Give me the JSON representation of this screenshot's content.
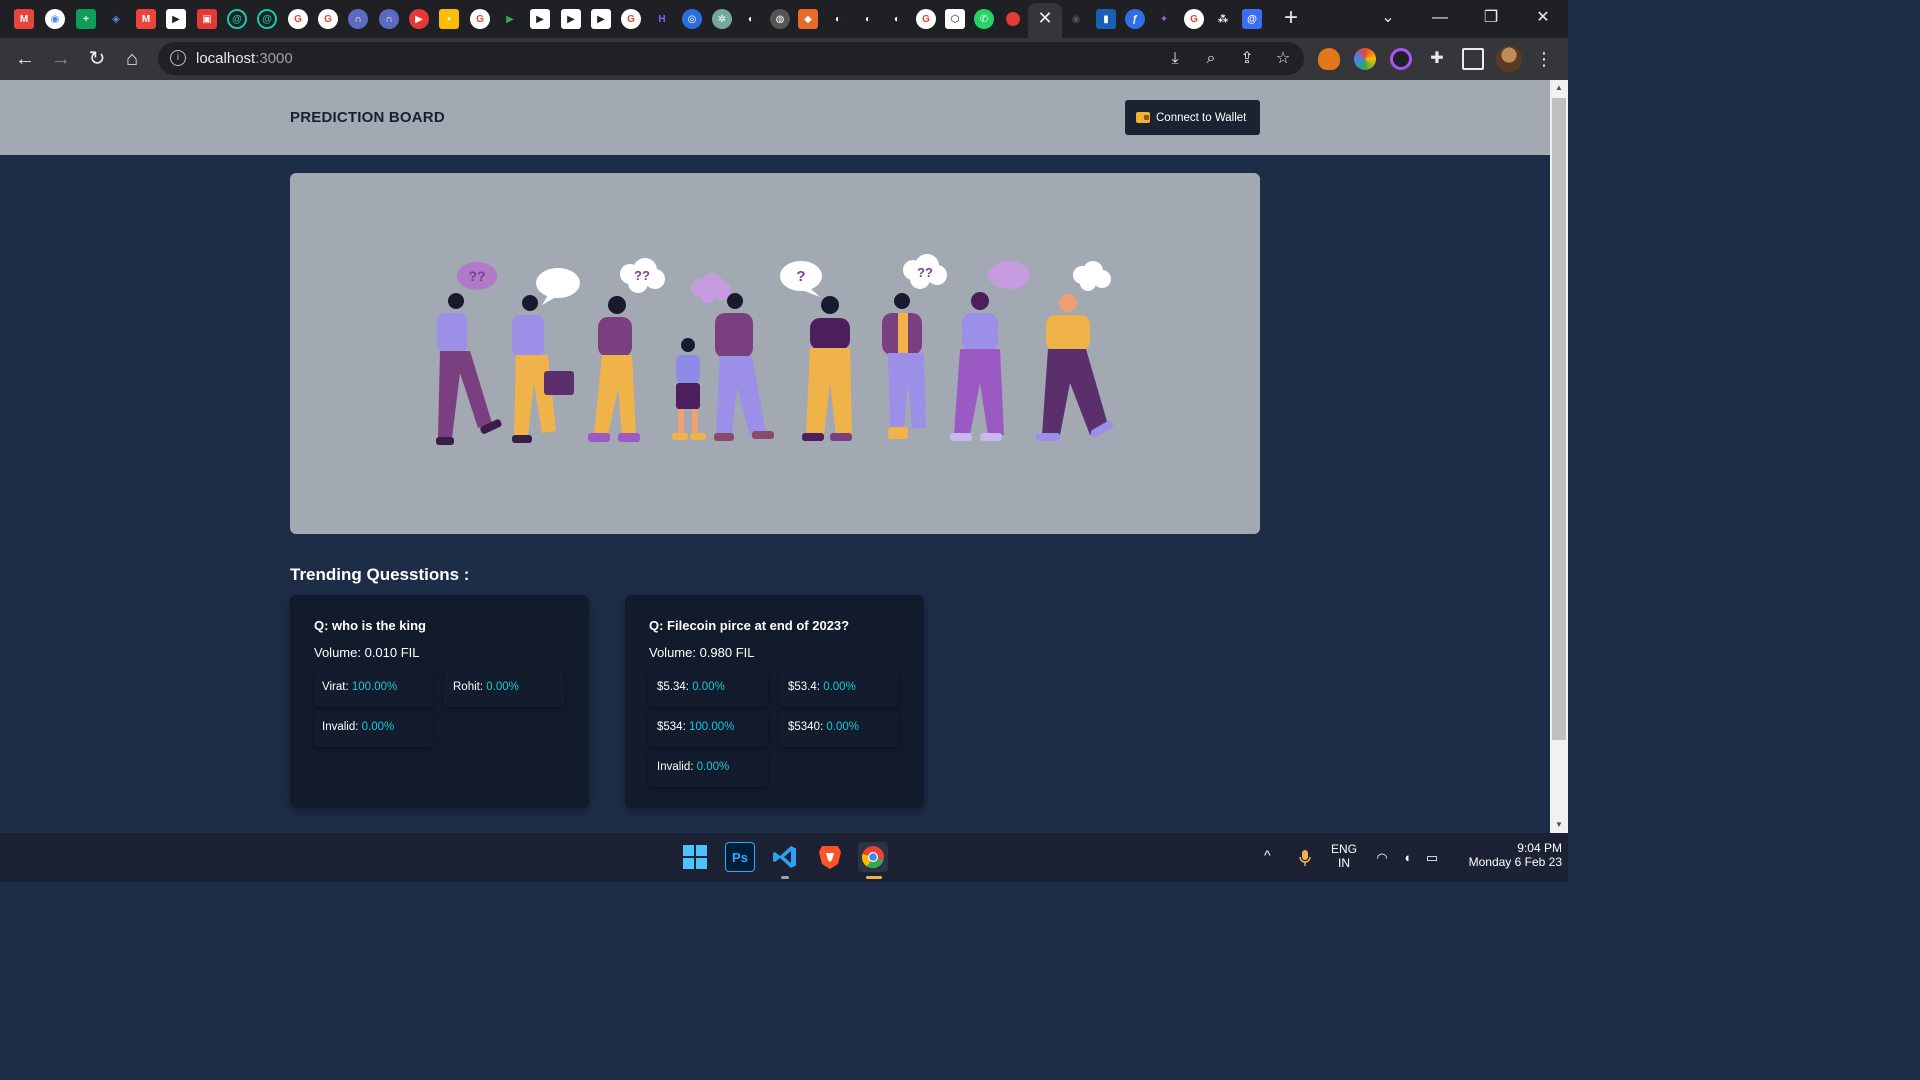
{
  "browser": {
    "url_host": "localhost",
    "url_port": ":3000",
    "tab_close_icon": "✕",
    "new_tab_icon": "+",
    "icons": {
      "back": "←",
      "forward": "→",
      "reload": "↻",
      "home": "⌂",
      "install": "⤓",
      "zoom": "⌕",
      "share": "⇪",
      "bookmark": "☆",
      "minimize": "—",
      "restore": "❐",
      "close": "✕",
      "tab_search": "⌄",
      "menu": "⋮"
    }
  },
  "app": {
    "brand": "PREDICTION BOARD",
    "wallet_button": "Connect to Wallet",
    "section_title": "Trending Quesstions :"
  },
  "questions": [
    {
      "question": "Q: who is the king",
      "volume": "Volume: 0.010 FIL",
      "options": [
        {
          "label": "Virat:",
          "pct": "100.00%"
        },
        {
          "label": "Rohit:",
          "pct": "0.00%"
        },
        {
          "label": "Invalid:",
          "pct": "0.00%"
        }
      ]
    },
    {
      "question": "Q: Filecoin pirce at end of 2023?",
      "volume": "Volume: 0.980 FIL",
      "options": [
        {
          "label": "$5.34:",
          "pct": "0.00%"
        },
        {
          "label": "$53.4:",
          "pct": "0.00%"
        },
        {
          "label": "$534:",
          "pct": "100.00%"
        },
        {
          "label": "$5340:",
          "pct": "0.00%"
        },
        {
          "label": "Invalid:",
          "pct": "0.00%"
        }
      ]
    }
  ],
  "hero": {
    "bubbles": [
      "??",
      "",
      "??",
      "",
      "?",
      "??",
      "",
      ""
    ]
  },
  "taskbar": {
    "apps": [
      {
        "name": "windows-start",
        "text": ""
      },
      {
        "name": "photoshop",
        "text": "Ps"
      },
      {
        "name": "vscode",
        "text": ""
      },
      {
        "name": "brave",
        "text": ""
      },
      {
        "name": "chrome",
        "text": ""
      }
    ],
    "chevron": "^",
    "lang_top": "ENG",
    "lang_bottom": "IN",
    "time": "9:04 PM",
    "date": "Monday 6 Feb 23"
  },
  "colors": {
    "page_bg": "#1e2d47",
    "header_bg": "#a3a9b3",
    "card_bg": "#111b2b",
    "accent_pct": "#19c6d6"
  }
}
